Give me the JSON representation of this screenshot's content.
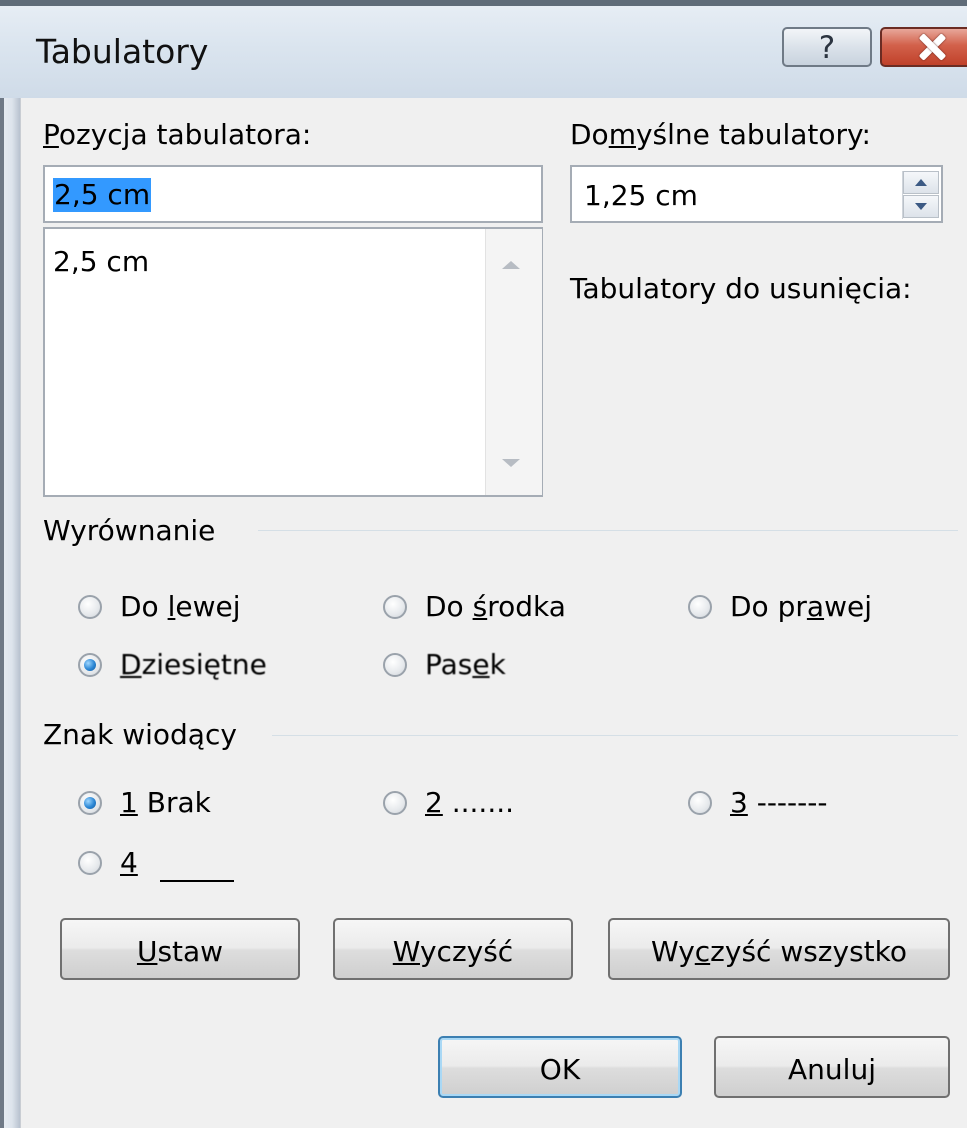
{
  "window": {
    "title": "Tabulatory",
    "help_glyph": "?",
    "close_icon": "close-x"
  },
  "tab_position": {
    "label_mnemonic": "P",
    "label_rest": "ozycja tabulatora:",
    "value": "2,5 cm",
    "list_items": [
      "2,5 cm"
    ]
  },
  "default_tabs": {
    "label_pre": "Do",
    "label_mnemonic": "m",
    "label_post": "yślne tabulatory:",
    "value": "1,25 cm"
  },
  "tabs_to_clear": {
    "label": "Tabulatory do usunięcia:"
  },
  "alignment": {
    "heading": "Wyrównanie",
    "options": [
      {
        "pre": "Do ",
        "mn": "l",
        "post": "ewej",
        "checked": false
      },
      {
        "pre": "Do ",
        "mn": "ś",
        "post": "rodka",
        "checked": false
      },
      {
        "pre": "Do pr",
        "mn": "a",
        "post": "wej",
        "checked": false
      },
      {
        "pre": "",
        "mn": "D",
        "post": "ziesiętne",
        "checked": true
      },
      {
        "pre": "Pas",
        "mn": "e",
        "post": "k",
        "checked": false
      }
    ]
  },
  "leader": {
    "heading": "Znak wiodący",
    "options": [
      {
        "mn": "1",
        "post": " Brak",
        "checked": true
      },
      {
        "mn": "2",
        "post": " .......",
        "checked": false
      },
      {
        "mn": "3",
        "post": " -------",
        "checked": false
      },
      {
        "mn": "4",
        "post": " ",
        "checked": false
      }
    ]
  },
  "buttons": {
    "set": {
      "mn": "U",
      "post": "staw"
    },
    "clear": {
      "mn": "W",
      "post": "yczyść"
    },
    "clear_all": {
      "pre": "Wy",
      "mn": "c",
      "post": "zyść wszystko"
    },
    "ok": "OK",
    "cancel": "Anuluj"
  },
  "colors": {
    "selection": "#3399ff",
    "default_button_border": "#3c7fb1",
    "radio_checked": "#2b86d4"
  }
}
